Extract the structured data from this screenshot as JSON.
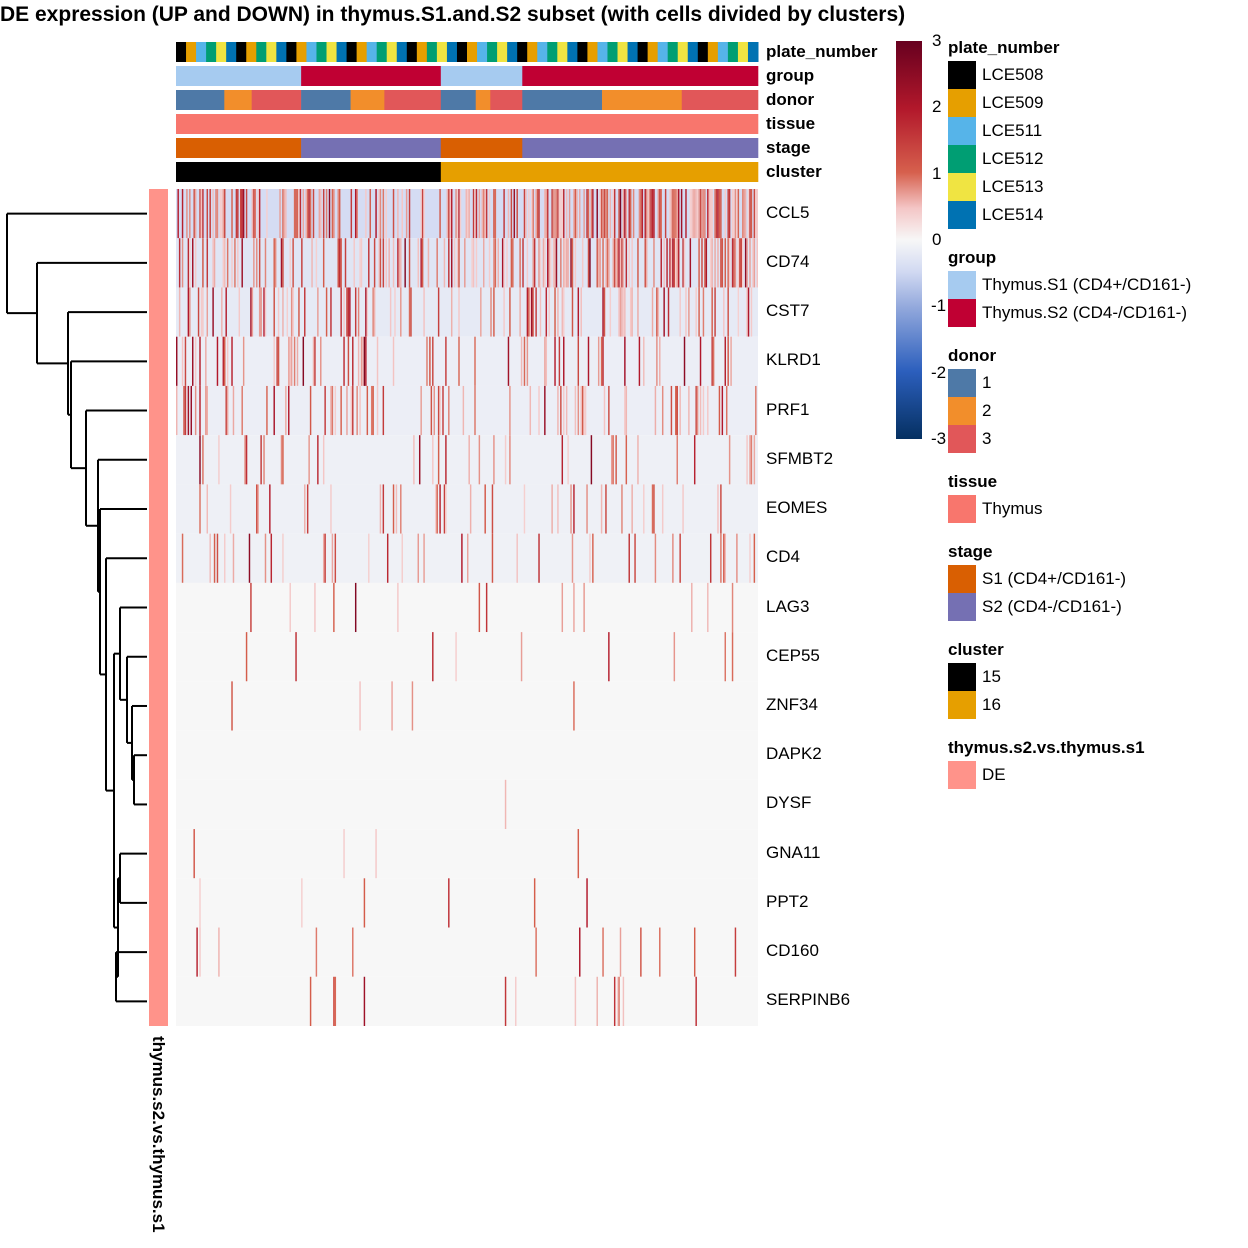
{
  "chart_data": {
    "type": "heatmap",
    "title": "DE expression (UP and DOWN) in thymus.S1.and.S2 subset (with cells divided by clusters)",
    "rows": [
      "CCL5",
      "CD74",
      "CST7",
      "KLRD1",
      "PRF1",
      "SFMBT2",
      "EOMES",
      "CD4",
      "LAG3",
      "CEP55",
      "ZNF34",
      "DAPK2",
      "DYSF",
      "GNA11",
      "PPT2",
      "CD160",
      "SERPINB6"
    ],
    "row_baseline_values": [
      -0.45,
      -0.3,
      -0.22,
      -0.15,
      -0.15,
      -0.12,
      -0.12,
      -0.1,
      0,
      0,
      0,
      0,
      0,
      0,
      0,
      0,
      0
    ],
    "row_spike_density": [
      0.45,
      0.35,
      0.22,
      0.16,
      0.18,
      0.09,
      0.09,
      0.08,
      0.03,
      0.02,
      0.01,
      0.005,
      0.005,
      0.02,
      0.02,
      0.03,
      0.03
    ],
    "n_cells": 400,
    "color_scale": {
      "min": -3,
      "max": 3,
      "ticks": [
        3,
        2,
        1,
        0,
        -1,
        -2,
        -3
      ],
      "low_color": "#053061",
      "mid_color": "#f7f7f7",
      "high_color": "#67001f"
    },
    "column_annotations": [
      {
        "name": "plate_number"
      },
      {
        "name": "group",
        "segments": [
          {
            "value": "Thymus.S1 (CD4+/CD161-)",
            "fraction": 0.215
          },
          {
            "value": "Thymus.S2 (CD4-/CD161-)",
            "fraction": 0.24
          },
          {
            "value": "Thymus.S1 (CD4+/CD161-)",
            "fraction": 0.14
          },
          {
            "value": "Thymus.S2 (CD4-/CD161-)",
            "fraction": 0.405
          }
        ]
      },
      {
        "name": "donor",
        "segments": [
          {
            "value": "1",
            "fraction": 0.083
          },
          {
            "value": "2",
            "fraction": 0.047
          },
          {
            "value": "3",
            "fraction": 0.085
          },
          {
            "value": "1",
            "fraction": 0.085
          },
          {
            "value": "2",
            "fraction": 0.058
          },
          {
            "value": "3",
            "fraction": 0.097
          },
          {
            "value": "1",
            "fraction": 0.06
          },
          {
            "value": "2",
            "fraction": 0.025
          },
          {
            "value": "3",
            "fraction": 0.055
          },
          {
            "value": "1",
            "fraction": 0.137
          },
          {
            "value": "2",
            "fraction": 0.137
          },
          {
            "value": "3",
            "fraction": 0.131
          }
        ]
      },
      {
        "name": "tissue",
        "segments": [
          {
            "value": "Thymus",
            "fraction": 1.0
          }
        ]
      },
      {
        "name": "stage",
        "segments": [
          {
            "value": "S1 (CD4+/CD161-)",
            "fraction": 0.215
          },
          {
            "value": "S2 (CD4-/CD161-)",
            "fraction": 0.24
          },
          {
            "value": "S1 (CD4+/CD161-)",
            "fraction": 0.14
          },
          {
            "value": "S2 (CD4-/CD161-)",
            "fraction": 0.405
          }
        ]
      },
      {
        "name": "cluster",
        "segments": [
          {
            "value": "15",
            "fraction": 0.455
          },
          {
            "value": "16",
            "fraction": 0.545
          }
        ]
      }
    ],
    "plate_sequence": [
      "LCE508",
      "LCE509",
      "LCE511",
      "LCE512",
      "LCE513",
      "LCE514",
      "LCE508",
      "LCE509",
      "LCE512",
      "LCE513",
      "LCE514",
      "LCE508",
      "LCE509",
      "LCE511",
      "LCE512",
      "LCE513",
      "LCE514",
      "LCE508",
      "LCE509",
      "LCE511",
      "LCE512",
      "LCE513",
      "LCE514",
      "LCE508",
      "LCE509",
      "LCE512",
      "LCE513",
      "LCE514",
      "LCE508",
      "LCE509",
      "LCE511",
      "LCE512",
      "LCE513",
      "LCE514",
      "LCE508",
      "LCE509",
      "LCE511",
      "LCE512",
      "LCE513",
      "LCE514",
      "LCE508",
      "LCE509",
      "LCE511",
      "LCE512",
      "LCE513",
      "LCE514",
      "LCE508",
      "LCE509",
      "LCE511",
      "LCE512",
      "LCE513",
      "LCE514",
      "LCE508",
      "LCE509",
      "LCE511",
      "LCE512",
      "LCE513",
      "LCE514"
    ],
    "row_annotation": {
      "name": "thymus.s2.vs.thymus.s1",
      "value": "DE"
    },
    "legends": [
      {
        "title": "plate_number",
        "items": [
          {
            "label": "LCE508",
            "color": "#000000"
          },
          {
            "label": "LCE509",
            "color": "#E69F00"
          },
          {
            "label": "LCE511",
            "color": "#56B4E9"
          },
          {
            "label": "LCE512",
            "color": "#009E73"
          },
          {
            "label": "LCE513",
            "color": "#F0E442"
          },
          {
            "label": "LCE514",
            "color": "#0072B2"
          }
        ]
      },
      {
        "title": "group",
        "items": [
          {
            "label": "Thymus.S1 (CD4+/CD161-)",
            "color": "#A6CBF0"
          },
          {
            "label": "Thymus.S2 (CD4-/CD161-)",
            "color": "#C00033"
          }
        ]
      },
      {
        "title": "donor",
        "items": [
          {
            "label": "1",
            "color": "#4E79A7"
          },
          {
            "label": "2",
            "color": "#F28E2B"
          },
          {
            "label": "3",
            "color": "#E15759"
          }
        ]
      },
      {
        "title": "tissue",
        "items": [
          {
            "label": "Thymus",
            "color": "#F8766D"
          }
        ]
      },
      {
        "title": "stage",
        "items": [
          {
            "label": "S1 (CD4+/CD161-)",
            "color": "#D95F02"
          },
          {
            "label": "S2 (CD4-/CD161-)",
            "color": "#7570B3"
          }
        ]
      },
      {
        "title": "cluster",
        "items": [
          {
            "label": "15",
            "color": "#000000"
          },
          {
            "label": "16",
            "color": "#E69F00"
          }
        ]
      },
      {
        "title": "thymus.s2.vs.thymus.s1",
        "items": [
          {
            "label": "DE",
            "color": "#FF938A"
          }
        ]
      }
    ]
  }
}
